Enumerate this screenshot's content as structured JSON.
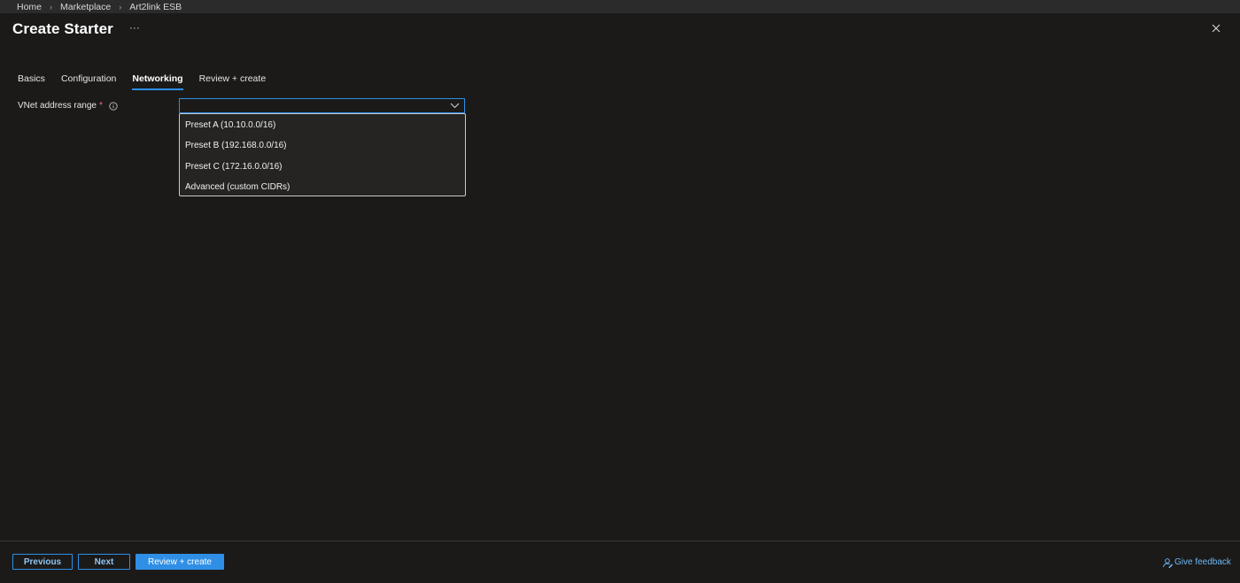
{
  "breadcrumb": {
    "items": [
      "Home",
      "Marketplace",
      "Art2link ESB"
    ],
    "separator": "›"
  },
  "header": {
    "title": "Create Starter",
    "more_label": "···"
  },
  "tabs": [
    {
      "label": "Basics",
      "active": false
    },
    {
      "label": "Configuration",
      "active": false
    },
    {
      "label": "Networking",
      "active": true
    },
    {
      "label": "Review + create",
      "active": false
    }
  ],
  "form": {
    "vnet_label": "VNet address range",
    "required_marker": "*",
    "selected_value": ""
  },
  "dropdown": {
    "options": [
      "Preset A (10.10.0.0/16)",
      "Preset B (192.168.0.0/16)",
      "Preset C (172.16.0.0/16)",
      "Advanced (custom CIDRs)"
    ]
  },
  "footer": {
    "previous_label": "Previous",
    "next_label": "Next",
    "review_label": "Review + create",
    "feedback_label": "Give feedback"
  },
  "colors": {
    "background": "#1b1a19",
    "accent": "#2f8fe6",
    "required": "#f1707b"
  },
  "icons": {
    "close": "close-icon",
    "info": "info-icon",
    "chevron": "chevron-down-icon",
    "feedback": "feedback-icon"
  }
}
